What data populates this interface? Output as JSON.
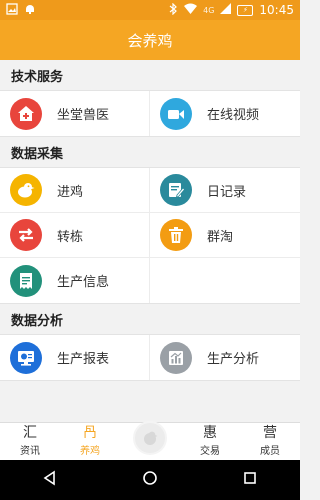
{
  "status_bar": {
    "network": "4G",
    "time": "10:45"
  },
  "app_title": "会养鸡",
  "sections": [
    {
      "title": "技术服务",
      "items": [
        {
          "label": "坐堂兽医",
          "icon": "vet-house-icon",
          "color": "#e8453c"
        },
        {
          "label": "在线视频",
          "icon": "video-camera-icon",
          "color": "#2fa8de"
        }
      ]
    },
    {
      "title": "数据采集",
      "items": [
        {
          "label": "进鸡",
          "icon": "chick-icon",
          "color": "#f5b400"
        },
        {
          "label": "日记录",
          "icon": "edit-log-icon",
          "color": "#2a8a9c"
        },
        {
          "label": "转栋",
          "icon": "transfer-arrows-icon",
          "color": "#e8453c"
        },
        {
          "label": "群淘",
          "icon": "trash-icon",
          "color": "#f39c12"
        },
        {
          "label": "生产信息",
          "icon": "document-icon",
          "color": "#22917b"
        }
      ]
    },
    {
      "title": "数据分析",
      "items": [
        {
          "label": "生产报表",
          "icon": "monitor-report-icon",
          "color": "#1e6fd9"
        },
        {
          "label": "生产分析",
          "icon": "analysis-chart-icon",
          "color": "#9aa0a6"
        }
      ]
    }
  ],
  "bottom_nav": [
    {
      "label": "资讯",
      "glyph": "汇",
      "active": false
    },
    {
      "label": "养鸡",
      "glyph": "冎",
      "active": true
    },
    {
      "label": "交易",
      "glyph": "惠",
      "active": false
    },
    {
      "label": "成员",
      "glyph": "营",
      "active": false
    }
  ]
}
